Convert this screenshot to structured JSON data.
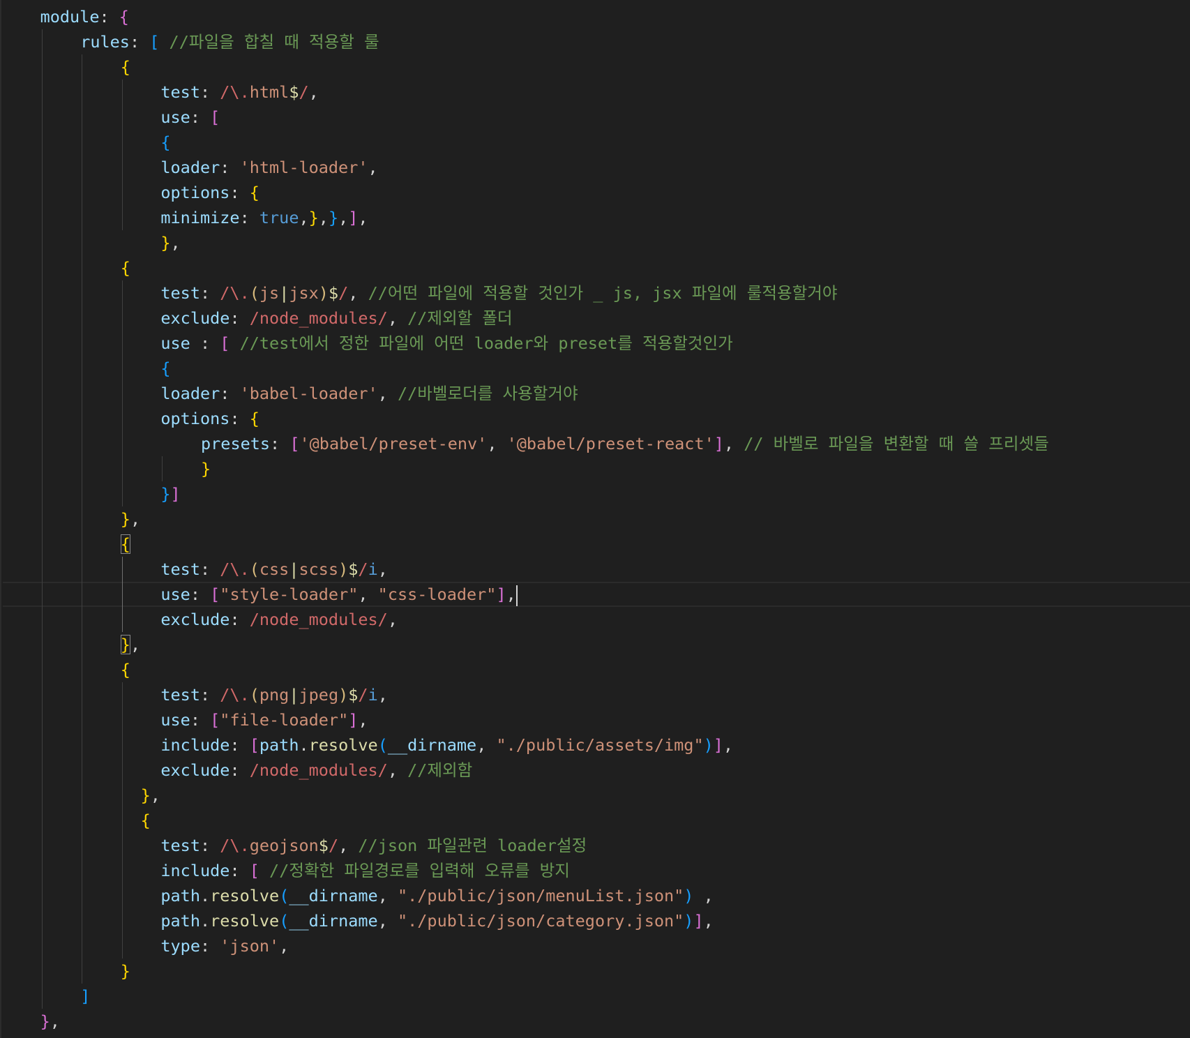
{
  "app": "code-editor",
  "theme": {
    "background": "#1f1f1f",
    "foreground": "#d4d4d4",
    "property": "#9cdcfe",
    "string": "#ce9178",
    "regex": "#d16969",
    "comment": "#6a9955",
    "keyword": "#569cd6",
    "function": "#dcdcaa",
    "bracket_level_1": "#ffd700",
    "bracket_level_2": "#da70d6",
    "bracket_level_3": "#179fff"
  },
  "editor": {
    "cursor_line": 24,
    "lines": [
      {
        "i": 4,
        "t": [
          [
            "k",
            "module"
          ],
          [
            "p",
            ": "
          ],
          [
            "b2",
            "{"
          ]
        ]
      },
      {
        "i": 8,
        "t": [
          [
            "k",
            "rules"
          ],
          [
            "p",
            ": "
          ],
          [
            "b3",
            "["
          ],
          [
            "p",
            " "
          ],
          [
            "c",
            "//파일을 합칠 때 적용할 룰"
          ]
        ]
      },
      {
        "i": 12,
        "t": [
          [
            "b1",
            "{"
          ]
        ]
      },
      {
        "i": 16,
        "t": [
          [
            "k",
            "test"
          ],
          [
            "p",
            ": "
          ],
          [
            "r",
            "/\\."
          ],
          [
            "s",
            "html"
          ],
          [
            "rs",
            "$"
          ],
          [
            "r",
            "/"
          ],
          [
            "p",
            ","
          ]
        ]
      },
      {
        "i": 16,
        "t": [
          [
            "k",
            "use"
          ],
          [
            "p",
            ": "
          ],
          [
            "b2",
            "["
          ]
        ]
      },
      {
        "i": 16,
        "t": [
          [
            "b3",
            "{"
          ]
        ]
      },
      {
        "i": 16,
        "t": [
          [
            "k",
            "loader"
          ],
          [
            "p",
            ": "
          ],
          [
            "s",
            "'html-loader'"
          ],
          [
            "p",
            ","
          ]
        ]
      },
      {
        "i": 16,
        "t": [
          [
            "k",
            "options"
          ],
          [
            "p",
            ": "
          ],
          [
            "b1",
            "{"
          ]
        ]
      },
      {
        "i": 16,
        "t": [
          [
            "k",
            "minimize"
          ],
          [
            "p",
            ": "
          ],
          [
            "b",
            "true"
          ],
          [
            "p",
            ","
          ],
          [
            "b1",
            "}"
          ],
          [
            "p",
            ","
          ],
          [
            "b3",
            "}"
          ],
          [
            "p",
            ","
          ],
          [
            "b2",
            "]"
          ],
          [
            "p",
            ","
          ]
        ]
      },
      {
        "i": 16,
        "t": [
          [
            "b1",
            "}"
          ],
          [
            "p",
            ","
          ]
        ]
      },
      {
        "i": 12,
        "t": [
          [
            "b1",
            "{"
          ]
        ]
      },
      {
        "i": 16,
        "t": [
          [
            "k",
            "test"
          ],
          [
            "p",
            ": "
          ],
          [
            "r",
            "/\\."
          ],
          [
            "re",
            "("
          ],
          [
            "s",
            "js"
          ],
          [
            "rs",
            "|"
          ],
          [
            "s",
            "jsx"
          ],
          [
            "re",
            ")"
          ],
          [
            "rs",
            "$"
          ],
          [
            "r",
            "/"
          ],
          [
            "p",
            ", "
          ],
          [
            "c",
            "//어떤 파일에 적용할 것인가 _ js, jsx 파일에 룰적용할거야"
          ]
        ]
      },
      {
        "i": 16,
        "t": [
          [
            "k",
            "exclude"
          ],
          [
            "p",
            ": "
          ],
          [
            "r",
            "/node_modules/"
          ],
          [
            "p",
            ", "
          ],
          [
            "c",
            "//제외할 폴더"
          ]
        ]
      },
      {
        "i": 16,
        "t": [
          [
            "k",
            "use"
          ],
          [
            "p",
            " : "
          ],
          [
            "b2",
            "["
          ],
          [
            "p",
            " "
          ],
          [
            "c",
            "//test에서 정한 파일에 어떤 loader와 preset를 적용할것인가"
          ]
        ]
      },
      {
        "i": 16,
        "t": [
          [
            "b3",
            "{"
          ]
        ]
      },
      {
        "i": 16,
        "t": [
          [
            "k",
            "loader"
          ],
          [
            "p",
            ": "
          ],
          [
            "s",
            "'babel-loader'"
          ],
          [
            "p",
            ", "
          ],
          [
            "c",
            "//바벨로더를 사용할거야"
          ]
        ]
      },
      {
        "i": 16,
        "t": [
          [
            "k",
            "options"
          ],
          [
            "p",
            ": "
          ],
          [
            "b1",
            "{"
          ]
        ]
      },
      {
        "i": 20,
        "t": [
          [
            "k",
            "presets"
          ],
          [
            "p",
            ": "
          ],
          [
            "b2",
            "["
          ],
          [
            "s",
            "'@babel/preset-env'"
          ],
          [
            "p",
            ", "
          ],
          [
            "s",
            "'@babel/preset-react'"
          ],
          [
            "b2",
            "]"
          ],
          [
            "p",
            ", "
          ],
          [
            "c",
            "// 바벨로 파일을 변환할 때 쓸 프리셋들"
          ]
        ]
      },
      {
        "i": 20,
        "t": [
          [
            "b1",
            "}"
          ]
        ]
      },
      {
        "i": 16,
        "t": [
          [
            "b3",
            "}"
          ],
          [
            "b2",
            "]"
          ]
        ]
      },
      {
        "i": 12,
        "t": [
          [
            "b1",
            "}"
          ],
          [
            "p",
            ","
          ]
        ]
      },
      {
        "i": 12,
        "t": [
          [
            "b1bm",
            "{"
          ]
        ]
      },
      {
        "i": 16,
        "t": [
          [
            "k",
            "test"
          ],
          [
            "p",
            ": "
          ],
          [
            "r",
            "/\\."
          ],
          [
            "re",
            "("
          ],
          [
            "s",
            "css"
          ],
          [
            "rs",
            "|"
          ],
          [
            "s",
            "scss"
          ],
          [
            "re",
            ")"
          ],
          [
            "rs",
            "$"
          ],
          [
            "r",
            "/"
          ],
          [
            "b",
            "i"
          ],
          [
            "p",
            ","
          ]
        ]
      },
      {
        "i": 16,
        "t": [
          [
            "k",
            "use"
          ],
          [
            "p",
            ": "
          ],
          [
            "b2",
            "["
          ],
          [
            "s",
            "\"style-loader\""
          ],
          [
            "p",
            ", "
          ],
          [
            "s",
            "\"css-loader\""
          ],
          [
            "b2",
            "]"
          ],
          [
            "p",
            ","
          ]
        ],
        "cursor": true
      },
      {
        "i": 16,
        "t": [
          [
            "k",
            "exclude"
          ],
          [
            "p",
            ": "
          ],
          [
            "r",
            "/node_modules/"
          ],
          [
            "p",
            ","
          ]
        ]
      },
      {
        "i": 12,
        "t": [
          [
            "b1bm",
            "}"
          ],
          [
            "p",
            ","
          ]
        ]
      },
      {
        "i": 12,
        "t": [
          [
            "b1",
            "{"
          ]
        ]
      },
      {
        "i": 16,
        "t": [
          [
            "k",
            "test"
          ],
          [
            "p",
            ": "
          ],
          [
            "r",
            "/\\."
          ],
          [
            "re",
            "("
          ],
          [
            "s",
            "png"
          ],
          [
            "rs",
            "|"
          ],
          [
            "s",
            "jpeg"
          ],
          [
            "re",
            ")"
          ],
          [
            "rs",
            "$"
          ],
          [
            "r",
            "/"
          ],
          [
            "b",
            "i"
          ],
          [
            "p",
            ","
          ]
        ]
      },
      {
        "i": 16,
        "t": [
          [
            "k",
            "use"
          ],
          [
            "p",
            ": "
          ],
          [
            "b2",
            "["
          ],
          [
            "s",
            "\"file-loader\""
          ],
          [
            "b2",
            "]"
          ],
          [
            "p",
            ","
          ]
        ]
      },
      {
        "i": 16,
        "t": [
          [
            "k",
            "include"
          ],
          [
            "p",
            ": "
          ],
          [
            "b2",
            "["
          ],
          [
            "k",
            "path"
          ],
          [
            "p",
            "."
          ],
          [
            "f",
            "resolve"
          ],
          [
            "b3",
            "("
          ],
          [
            "k",
            "__dirname"
          ],
          [
            "p",
            ", "
          ],
          [
            "s",
            "\"./public/assets/img\""
          ],
          [
            "b3",
            ")"
          ],
          [
            "b2",
            "]"
          ],
          [
            "p",
            ","
          ]
        ]
      },
      {
        "i": 16,
        "t": [
          [
            "k",
            "exclude"
          ],
          [
            "p",
            ": "
          ],
          [
            "r",
            "/node_modules/"
          ],
          [
            "p",
            ", "
          ],
          [
            "c",
            "//제외함"
          ]
        ]
      },
      {
        "i": 14,
        "t": [
          [
            "b1",
            "}"
          ],
          [
            "p",
            ","
          ]
        ]
      },
      {
        "i": 14,
        "t": [
          [
            "b1",
            "{"
          ]
        ]
      },
      {
        "i": 16,
        "t": [
          [
            "k",
            "test"
          ],
          [
            "p",
            ": "
          ],
          [
            "r",
            "/\\."
          ],
          [
            "s",
            "geojson"
          ],
          [
            "rs",
            "$"
          ],
          [
            "r",
            "/"
          ],
          [
            "p",
            ", "
          ],
          [
            "c",
            "//json 파일관련 loader설정"
          ]
        ]
      },
      {
        "i": 16,
        "t": [
          [
            "k",
            "include"
          ],
          [
            "p",
            ": "
          ],
          [
            "b2",
            "["
          ],
          [
            "p",
            " "
          ],
          [
            "c",
            "//정확한 파일경로를 입력해 오류를 방지"
          ]
        ]
      },
      {
        "i": 16,
        "t": [
          [
            "k",
            "path"
          ],
          [
            "p",
            "."
          ],
          [
            "f",
            "resolve"
          ],
          [
            "b3",
            "("
          ],
          [
            "k",
            "__dirname"
          ],
          [
            "p",
            ", "
          ],
          [
            "s",
            "\"./public/json/menuList.json\""
          ],
          [
            "b3",
            ")"
          ],
          [
            "p",
            " ,"
          ]
        ]
      },
      {
        "i": 16,
        "t": [
          [
            "k",
            "path"
          ],
          [
            "p",
            "."
          ],
          [
            "f",
            "resolve"
          ],
          [
            "b3",
            "("
          ],
          [
            "k",
            "__dirname"
          ],
          [
            "p",
            ", "
          ],
          [
            "s",
            "\"./public/json/category.json\""
          ],
          [
            "b3",
            ")"
          ],
          [
            "b2",
            "]"
          ],
          [
            "p",
            ","
          ]
        ]
      },
      {
        "i": 16,
        "t": [
          [
            "k",
            "type"
          ],
          [
            "p",
            ": "
          ],
          [
            "s",
            "'json'"
          ],
          [
            "p",
            ","
          ]
        ]
      },
      {
        "i": 12,
        "t": [
          [
            "b1",
            "}"
          ]
        ]
      },
      {
        "i": 8,
        "t": [
          [
            "b3",
            "]"
          ]
        ]
      },
      {
        "i": 4,
        "t": [
          [
            "b2",
            "}"
          ],
          [
            "p",
            ","
          ]
        ]
      }
    ]
  }
}
